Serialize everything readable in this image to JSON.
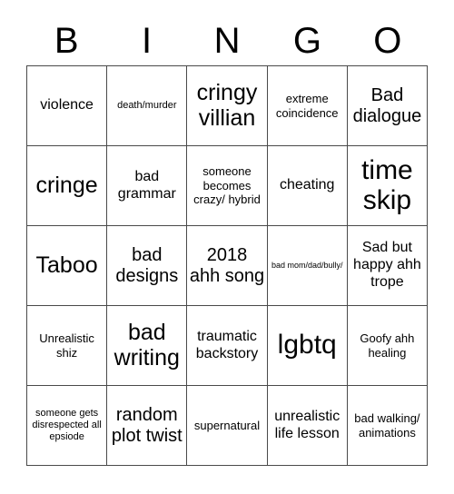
{
  "card": {
    "title_letters": [
      "B",
      "I",
      "N",
      "G",
      "O"
    ],
    "columns": 5,
    "rows": 5,
    "border_color": "#4a4a4a",
    "background_color": "#ffffff",
    "text_color": "#000000",
    "cells": [
      [
        {
          "text": "violence",
          "size": "lg"
        },
        {
          "text": "death/murder",
          "size": "sm"
        },
        {
          "text": "cringy villian",
          "size": "xxl"
        },
        {
          "text": "extreme coincidence",
          "size": "md"
        },
        {
          "text": "Bad dialogue",
          "size": "xl"
        }
      ],
      [
        {
          "text": "cringe",
          "size": "xxl"
        },
        {
          "text": "bad grammar",
          "size": "lg"
        },
        {
          "text": "someone becomes crazy/ hybrid",
          "size": "md"
        },
        {
          "text": "cheating",
          "size": "lg"
        },
        {
          "text": "time skip",
          "size": "hug"
        }
      ],
      [
        {
          "text": "Taboo",
          "size": "xxl"
        },
        {
          "text": "bad designs",
          "size": "xl"
        },
        {
          "text": "2018 ahh song",
          "size": "xl"
        },
        {
          "text": "bad mom/dad/bully/",
          "size": "xs"
        },
        {
          "text": "Sad but happy ahh trope",
          "size": "lg"
        }
      ],
      [
        {
          "text": "Unrealistic shiz",
          "size": "md"
        },
        {
          "text": "bad writing",
          "size": "xxl"
        },
        {
          "text": "traumatic backstory",
          "size": "lg"
        },
        {
          "text": "lgbtq",
          "size": "hug"
        },
        {
          "text": "Goofy ahh healing",
          "size": "md"
        }
      ],
      [
        {
          "text": "someone gets disrespected all epsiode",
          "size": "sm"
        },
        {
          "text": "random plot twist",
          "size": "xl"
        },
        {
          "text": "supernatural",
          "size": "md"
        },
        {
          "text": "unrealistic life lesson",
          "size": "lg"
        },
        {
          "text": "bad walking/ animations",
          "size": "md"
        }
      ]
    ]
  }
}
